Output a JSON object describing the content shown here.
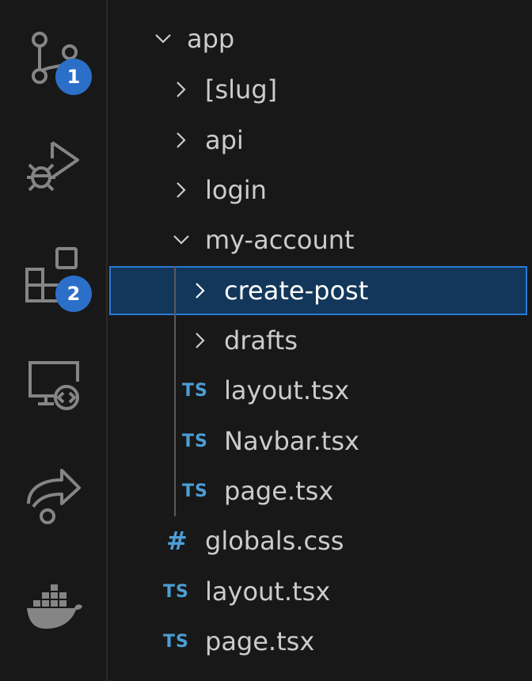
{
  "activity_bar": {
    "items": [
      {
        "name": "source-control",
        "badge": "1"
      },
      {
        "name": "run-and-debug",
        "badge": ""
      },
      {
        "name": "extensions",
        "badge": "2"
      },
      {
        "name": "remote-explorer",
        "badge": ""
      },
      {
        "name": "live-share",
        "badge": ""
      },
      {
        "name": "docker",
        "badge": ""
      }
    ]
  },
  "explorer": {
    "items": [
      {
        "label": "app",
        "kind": "folder",
        "expanded": true
      },
      {
        "label": "[slug]",
        "kind": "folder",
        "expanded": false
      },
      {
        "label": "api",
        "kind": "folder",
        "expanded": false
      },
      {
        "label": "login",
        "kind": "folder",
        "expanded": false
      },
      {
        "label": "my-account",
        "kind": "folder",
        "expanded": true
      },
      {
        "label": "create-post",
        "kind": "folder",
        "expanded": false,
        "selected": true
      },
      {
        "label": "drafts",
        "kind": "folder",
        "expanded": false
      },
      {
        "label": "layout.tsx",
        "kind": "ts"
      },
      {
        "label": "Navbar.tsx",
        "kind": "ts"
      },
      {
        "label": "page.tsx",
        "kind": "ts"
      },
      {
        "label": "globals.css",
        "kind": "css"
      },
      {
        "label": "layout.tsx",
        "kind": "ts"
      },
      {
        "label": "page.tsx",
        "kind": "ts"
      }
    ],
    "ts_icon_text": "TS",
    "css_icon_text": "#"
  },
  "colors": {
    "background": "#181818",
    "selection_bg": "#12375a",
    "selection_border": "#2b79d6",
    "badge": "#2b6fc9",
    "file_icon": "#4d9ed6",
    "icon_gray": "#858585",
    "text": "#cccccc"
  }
}
